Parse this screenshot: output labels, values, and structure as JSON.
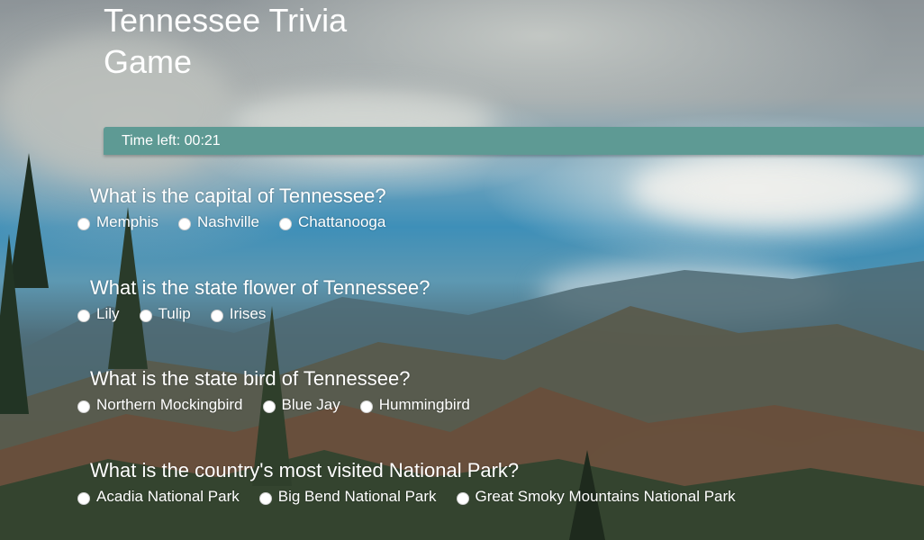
{
  "page": {
    "title": "Tennessee Trivia Game"
  },
  "timer": {
    "label": "Time left: 00:21"
  },
  "questions": [
    {
      "text": "What is the capital of Tennessee?",
      "options": [
        "Memphis",
        "Nashville",
        "Chattanooga"
      ]
    },
    {
      "text": "What is the state flower of Tennessee?",
      "options": [
        "Lily",
        "Tulip",
        "Irises"
      ]
    },
    {
      "text": "What is the state bird of Tennessee?",
      "options": [
        "Northern Mockingbird",
        "Blue Jay",
        "Hummingbird"
      ]
    },
    {
      "text": "What is the country's most visited National Park?",
      "options": [
        "Acadia National Park",
        "Big Bend National Park",
        "Great Smoky Mountains National Park"
      ]
    }
  ],
  "colors": {
    "timer_bar": "#5e9a94",
    "text": "#ffffff"
  }
}
